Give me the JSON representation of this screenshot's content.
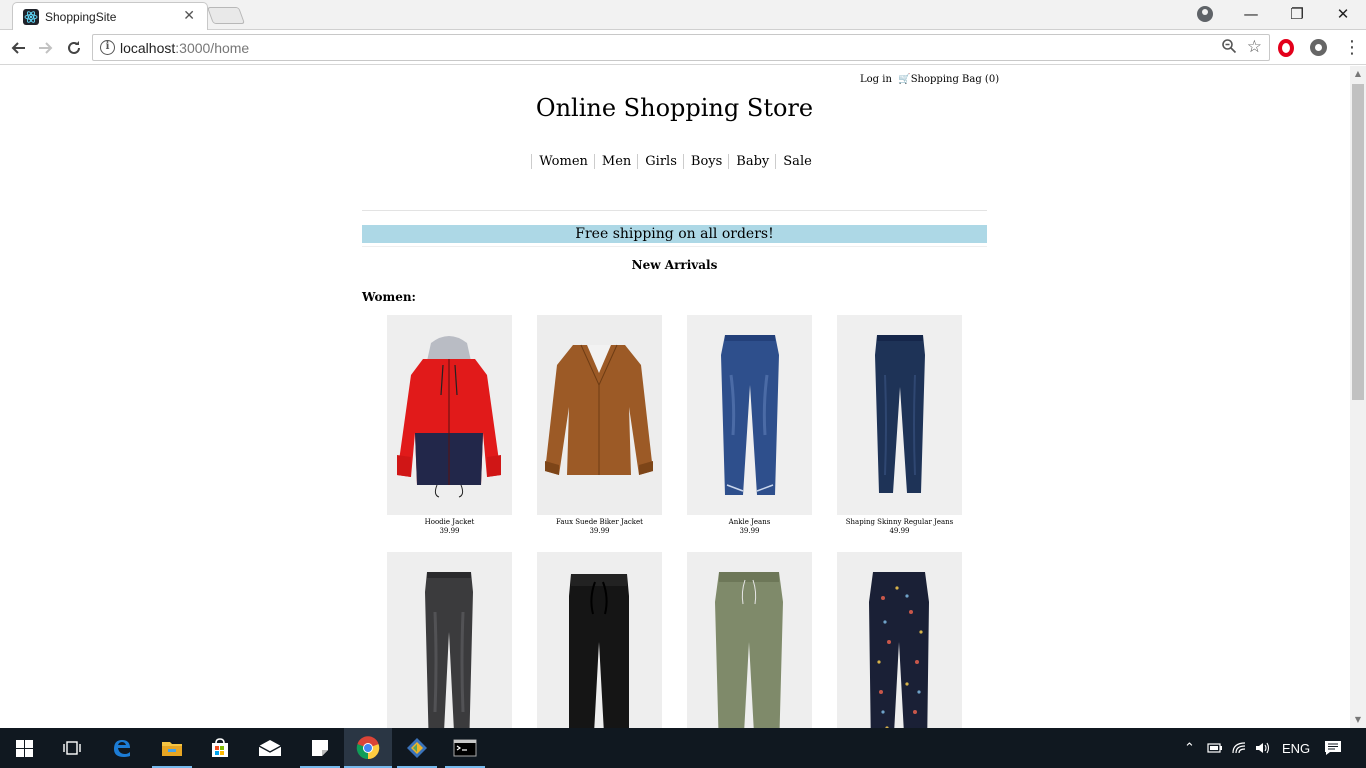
{
  "browser": {
    "tab_title": "ShoppingSite",
    "tab_close": "✕",
    "url_host": "localhost",
    "url_path": ":3000/home",
    "window_minimize": "—",
    "window_restore": "❐",
    "window_close": "✕",
    "icons": [
      "react-favicon-icon",
      "info-icon",
      "zoom-icon",
      "star-icon",
      "opera-icon",
      "extension-icon",
      "menu-icon",
      "profile-icon"
    ]
  },
  "site": {
    "login": "Log in",
    "cart_label": "Shopping Bag (0)",
    "title": "Online Shopping Store",
    "categories": [
      "Women",
      "Men",
      "Girls",
      "Boys",
      "Baby",
      "Sale"
    ],
    "banner": "Free shipping on all orders!",
    "section_title": "New Arrivals",
    "group_label": "Women:",
    "products": [
      {
        "name": "Hoodie Jacket",
        "price": "39.99"
      },
      {
        "name": "Faux Suede Biker Jacket",
        "price": "39.99"
      },
      {
        "name": "Ankle Jeans",
        "price": "39.99"
      },
      {
        "name": "Shaping Skinny Regular Jeans",
        "price": "49.99"
      },
      {
        "name": "",
        "price": ""
      },
      {
        "name": "",
        "price": ""
      },
      {
        "name": "",
        "price": ""
      },
      {
        "name": "",
        "price": ""
      }
    ]
  },
  "taskbar": {
    "language": "ENG",
    "pinned": [
      "start-icon",
      "task-view-icon",
      "edge-icon",
      "file-explorer-icon",
      "store-icon",
      "mail-icon",
      "sticky-notes-icon",
      "chrome-icon",
      "sourcetree-icon",
      "terminal-icon"
    ]
  }
}
